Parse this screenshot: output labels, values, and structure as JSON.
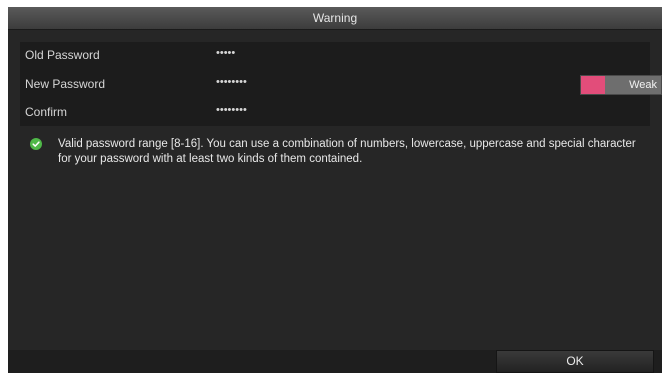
{
  "dialog": {
    "title": "Warning"
  },
  "form": {
    "old_password": {
      "label": "Old Password",
      "value": "•••••"
    },
    "new_password": {
      "label": "New Password",
      "value": "••••••••"
    },
    "confirm": {
      "label": "Confirm",
      "value": "••••••••"
    }
  },
  "strength": {
    "label": "Weak",
    "level": 0.3,
    "fill_color": "#e24d7a"
  },
  "hint": {
    "icon": "check-circle-icon",
    "icon_color": "#4fb848",
    "text": "Valid password range [8-16]. You can use a combination of numbers, lowercase, uppercase and special character for your password with at least two kinds of them contained."
  },
  "footer": {
    "ok_label": "OK"
  }
}
